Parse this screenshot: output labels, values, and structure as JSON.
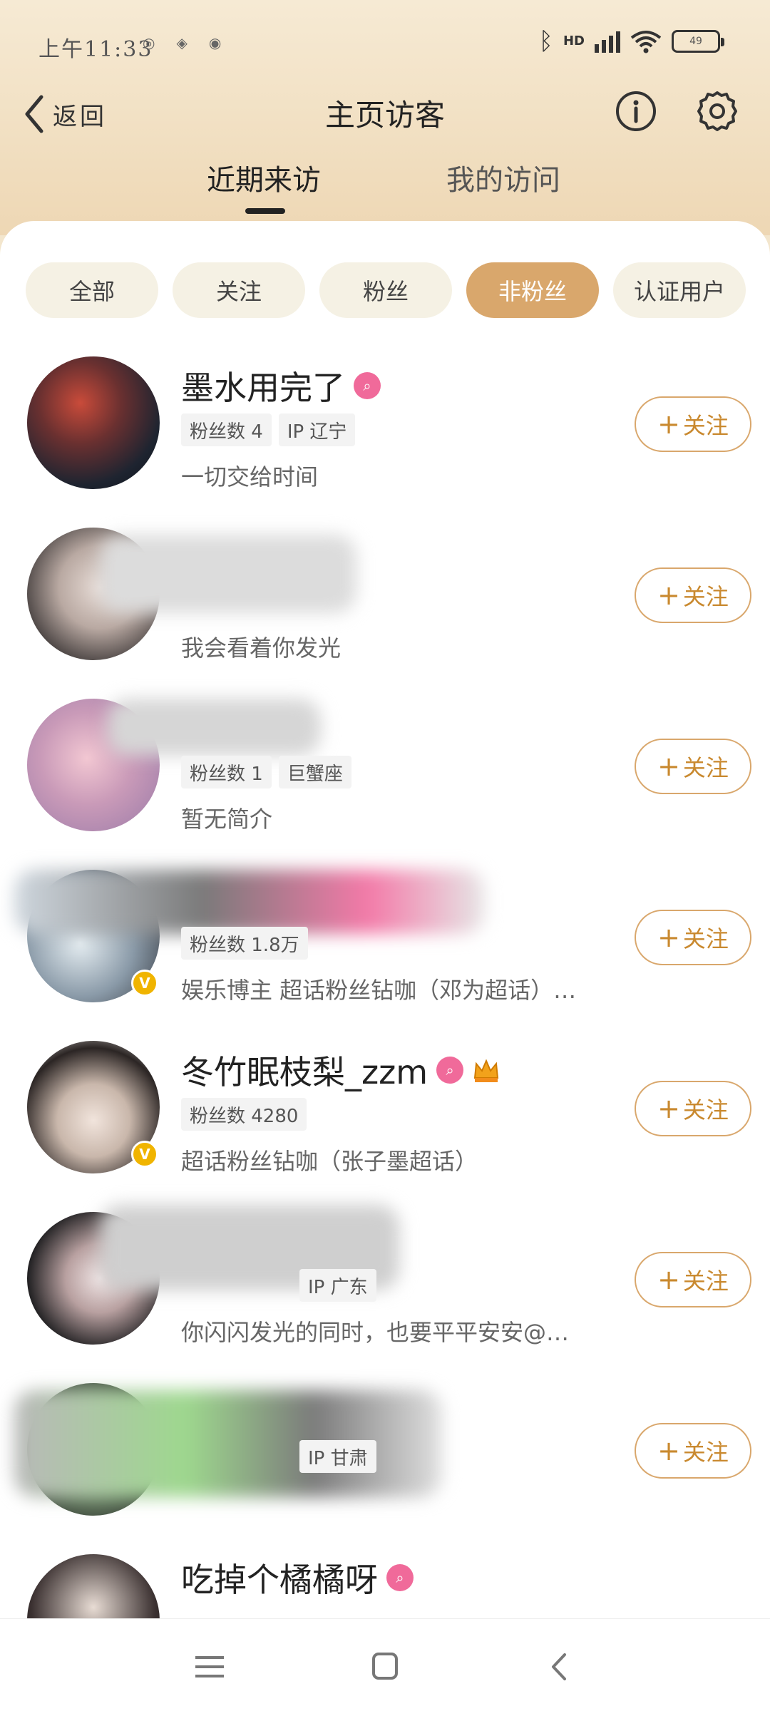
{
  "status": {
    "time": "上午11:33",
    "battery": "49"
  },
  "nav": {
    "back_label": "返回",
    "title": "主页访客"
  },
  "tabs": [
    {
      "label": "近期来访"
    },
    {
      "label": "我的访问"
    }
  ],
  "filters": [
    {
      "label": "全部"
    },
    {
      "label": "关注"
    },
    {
      "label": "粉丝"
    },
    {
      "label": "非粉丝"
    },
    {
      "label": "认证用户"
    }
  ],
  "follow_label": "关注",
  "visitors": [
    {
      "name": "墨水用完了",
      "tags": [
        "粉丝数 4",
        "IP 辽宁"
      ],
      "bio": "一切交给时间"
    },
    {
      "name": "",
      "tags": [],
      "bio": "我会看着你发光"
    },
    {
      "name": "",
      "tags": [
        "粉丝数 1",
        "巨蟹座"
      ],
      "bio": "暂无简介"
    },
    {
      "name": "",
      "tags": [
        "粉丝数 1.8万"
      ],
      "bio": "娱乐博主 超话粉丝钻咖（邓为超话）…"
    },
    {
      "name": "冬竹眠枝梨_zzm",
      "tags": [
        "粉丝数 4280"
      ],
      "bio": "超话粉丝钻咖（张子墨超话）"
    },
    {
      "name": "",
      "tags": [
        "IP 广东"
      ],
      "bio": "你闪闪发光的同时，也要平平安安@…"
    },
    {
      "name": "",
      "tags": [
        "IP 甘肃"
      ],
      "bio": ""
    },
    {
      "name": "吃掉个橘橘呀",
      "tags": [],
      "bio": ""
    }
  ]
}
